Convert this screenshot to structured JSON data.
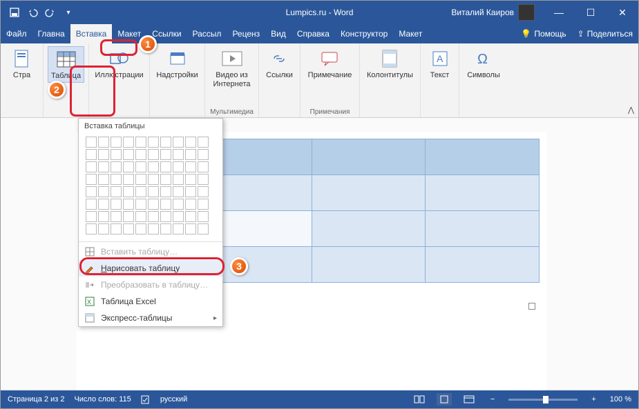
{
  "titlebar": {
    "title": "Lumpics.ru - Word",
    "user": "Виталий Каиров"
  },
  "tabs": {
    "file": "Файл",
    "home": "Главна",
    "insert": "Вставка",
    "layout1": "Макет",
    "refs": "Ссылки",
    "mail": "Рассыл",
    "review": "Реценз",
    "view": "Вид",
    "help": "Справка",
    "design": "Конструктор",
    "layout2": "Макет",
    "assist": "Помощь",
    "share": "Поделиться"
  },
  "ribbon": {
    "pages": "Стра",
    "table": "Таблица",
    "illus": "Иллюстрации",
    "addins": "Надстройки",
    "video": "Видео из Интернета",
    "media_grp": "Мультимедиа",
    "links": "Ссылки",
    "comment": "Примечание",
    "comment_grp": "Примечания",
    "headers": "Колонтитулы",
    "text": "Текст",
    "symbols": "Символы"
  },
  "dropdown": {
    "title": "Вставка таблицы",
    "insert": "Вставить таблицу…",
    "draw": "Нарисовать таблицу",
    "convert": "Преобразовать в таблицу…",
    "excel": "Таблица Excel",
    "quick": "Экспресс-таблицы"
  },
  "badges": {
    "b1": "1",
    "b2": "2",
    "b3": "3"
  },
  "status": {
    "page": "Страница 2 из 2",
    "words": "Число слов: 115",
    "lang": "русский",
    "zoom": "100 %"
  },
  "chart_data": {
    "type": "table",
    "rows": 4,
    "cols": 4,
    "header_row": true,
    "cell_contents": "empty"
  }
}
